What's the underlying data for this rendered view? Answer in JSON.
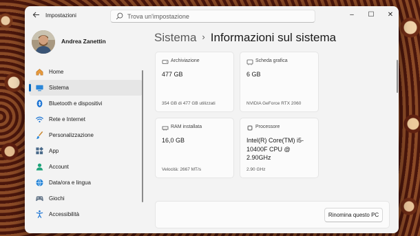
{
  "window": {
    "title": "Impostazioni",
    "controls": {
      "minimize": "–",
      "maximize": "☐",
      "close": "✕"
    }
  },
  "search": {
    "placeholder": "Trova un'impostazione"
  },
  "user": {
    "name": "Andrea Zanettin"
  },
  "sidebar": {
    "items": [
      {
        "label": "Home",
        "icon": "home-icon"
      },
      {
        "label": "Sistema",
        "icon": "system-icon",
        "active": true
      },
      {
        "label": "Bluetooth e dispositivi",
        "icon": "bluetooth-icon"
      },
      {
        "label": "Rete e Internet",
        "icon": "wifi-icon"
      },
      {
        "label": "Personalizzazione",
        "icon": "brush-icon"
      },
      {
        "label": "App",
        "icon": "apps-icon"
      },
      {
        "label": "Account",
        "icon": "account-icon"
      },
      {
        "label": "Data/ora e lingua",
        "icon": "globe-clock-icon"
      },
      {
        "label": "Giochi",
        "icon": "gamepad-icon"
      },
      {
        "label": "Accessibilità",
        "icon": "accessibility-icon"
      }
    ]
  },
  "breadcrumb": {
    "parent": "Sistema",
    "separator": "›",
    "current": "Informazioni sul sistema"
  },
  "cards": {
    "storage": {
      "caption": "Archiviazione",
      "value": "477 GB",
      "detail": "354 GB di 477 GB utilizzati",
      "icon": "storage-icon"
    },
    "gpu": {
      "caption": "Scheda grafica",
      "value": "6 GB",
      "detail": "NVIDIA GeForce RTX 2060",
      "icon": "gpu-icon"
    },
    "ram": {
      "caption": "RAM installata",
      "value": "16,0 GB",
      "detail": "Velocità: 2667 MT/s",
      "icon": "ram-icon"
    },
    "cpu": {
      "caption": "Processore",
      "value": "Intel(R) Core(TM) i5-10400F CPU @ 2.90GHz",
      "detail": "2.90 GHz",
      "icon": "cpu-icon"
    }
  },
  "rename": {
    "button_label": "Rinomina questo PC"
  },
  "colors": {
    "accent": "#0067c0",
    "window_bg": "#f3f3f3",
    "card_bg": "#fbfbfb"
  }
}
